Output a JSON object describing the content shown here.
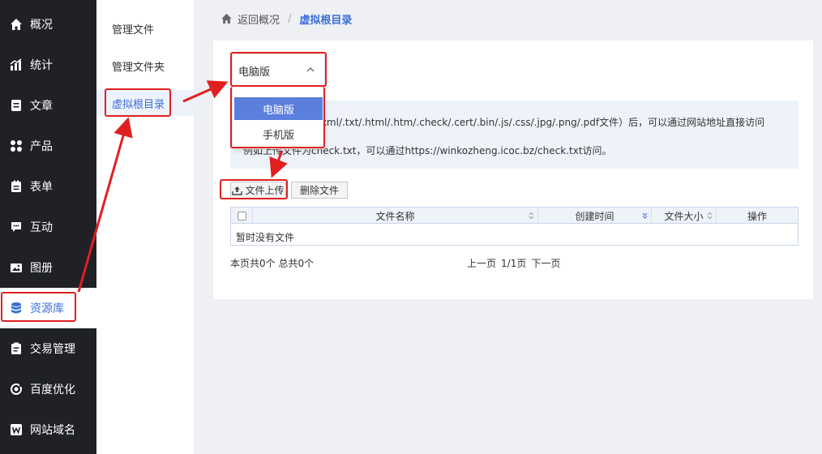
{
  "nav": {
    "items": [
      {
        "label": "概况",
        "icon": "home-icon"
      },
      {
        "label": "统计",
        "icon": "stats-icon"
      },
      {
        "label": "文章",
        "icon": "article-icon"
      },
      {
        "label": "产品",
        "icon": "grid-icon"
      },
      {
        "label": "表单",
        "icon": "form-icon"
      },
      {
        "label": "互动",
        "icon": "chat-icon"
      },
      {
        "label": "图册",
        "icon": "album-icon"
      },
      {
        "label": "资源库",
        "icon": "database-icon",
        "active": true
      },
      {
        "label": "交易管理",
        "icon": "trade-icon"
      },
      {
        "label": "百度优化",
        "icon": "seo-icon"
      },
      {
        "label": "网站域名",
        "icon": "domain-icon"
      }
    ]
  },
  "subnav": {
    "items": [
      {
        "label": "管理文件"
      },
      {
        "label": "管理文件夹"
      },
      {
        "label": "虚拟根目录",
        "active": true
      }
    ]
  },
  "breadcrumb": {
    "back": "返回概况",
    "separator": "/",
    "current": "虚拟根目录"
  },
  "dropdown": {
    "selected": "电脑版",
    "options": [
      "电脑版",
      "手机版"
    ]
  },
  "info": {
    "line1": "支持.xml/.txt/.html/.htm/.check/.cert/.bin/.js/.css/.jpg/.png/.pdf文件）后，可以通过网站地址直接访问",
    "line2": "例如上传文件为check.txt，可以通过https://winkozheng.icoc.bz/check.txt访问。"
  },
  "toolbar": {
    "upload_label": "文件上传",
    "delete_label": "删除文件"
  },
  "table": {
    "columns": [
      "文件名称",
      "创建时间",
      "文件大小",
      "操作"
    ],
    "empty_text": "暂时没有文件"
  },
  "pager": {
    "summary": "本页共0个 总共0个",
    "prev": "上一页",
    "page": "1/1页",
    "next": "下一页"
  },
  "colors": {
    "accent": "#3a6fd8",
    "annotation": "#e02020",
    "nav_bg": "#1f2127"
  }
}
